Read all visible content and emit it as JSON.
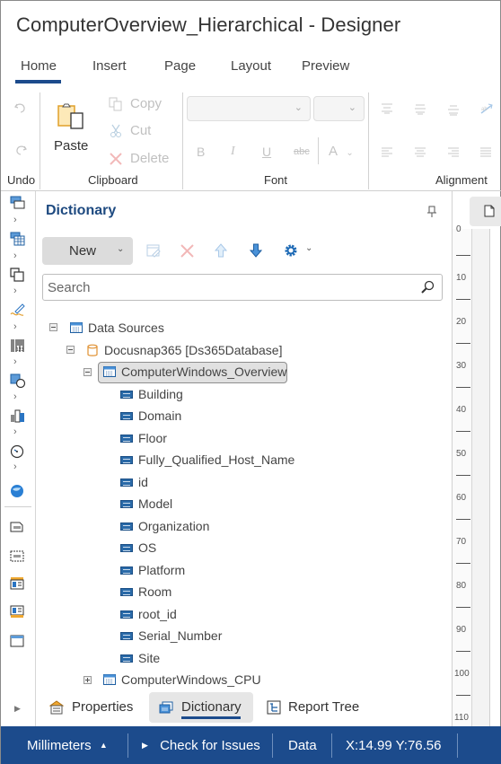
{
  "window": {
    "title": "ComputerOverview_Hierarchical - Designer"
  },
  "ribbon": {
    "tabs": [
      {
        "label": "Home",
        "active": true
      },
      {
        "label": "Insert"
      },
      {
        "label": "Page"
      },
      {
        "label": "Layout"
      },
      {
        "label": "Preview"
      }
    ],
    "groups": {
      "undo": {
        "label": "Undo",
        "undo_icon": "undo-icon",
        "redo_icon": "redo-icon"
      },
      "clipboard": {
        "label": "Clipboard",
        "paste": "Paste",
        "copy": "Copy",
        "cut": "Cut",
        "delete": "Delete"
      },
      "font": {
        "label": "Font",
        "font_name_value": "",
        "font_size_value": "",
        "bold": "B",
        "italic": "I",
        "underline": "U",
        "strike": "abc",
        "color": "A"
      },
      "alignment": {
        "label": "Alignment"
      }
    }
  },
  "toolbox": {
    "items": [
      "text-component-icon",
      "table-component-icon",
      "panel-component-icon",
      "signature-component-icon",
      "barcode-component-icon",
      "shape-component-icon",
      "chart-component-icon",
      "gauge-component-icon",
      "map-component-icon",
      "page-header-band-icon",
      "page-footer-band-icon",
      "header-band-icon",
      "footer-band-icon",
      "data-band-icon"
    ]
  },
  "dictionary": {
    "title": "Dictionary",
    "new_button": "New",
    "search_placeholder": "Search",
    "tree": {
      "root": "Data Sources",
      "connection": "Docusnap365 [Ds365Database]",
      "selected_source": "ComputerWindows_Overview",
      "fields": [
        "Building",
        "Domain",
        "Floor",
        "Fully_Qualified_Host_Name",
        "id",
        "Model",
        "Organization",
        "OS",
        "Platform",
        "Room",
        "root_id",
        "Serial_Number",
        "Site"
      ],
      "collapsed_source": "ComputerWindows_CPU"
    }
  },
  "panel_tabs": [
    {
      "label": "Properties"
    },
    {
      "label": "Dictionary",
      "active": true
    },
    {
      "label": "Report Tree"
    }
  ],
  "ruler": {
    "labels": [
      "0",
      "10",
      "20",
      "30",
      "40",
      "50",
      "60",
      "70",
      "80",
      "90",
      "100",
      "110"
    ]
  },
  "status_bar": {
    "units": "Millimeters",
    "check": "Check for Issues",
    "data": "Data",
    "coords": "X:14.99 Y:76.56"
  },
  "colors": {
    "accent": "#1c4b8c",
    "title_blue": "#1e4a80",
    "status_bg": "#1c4b8c"
  }
}
